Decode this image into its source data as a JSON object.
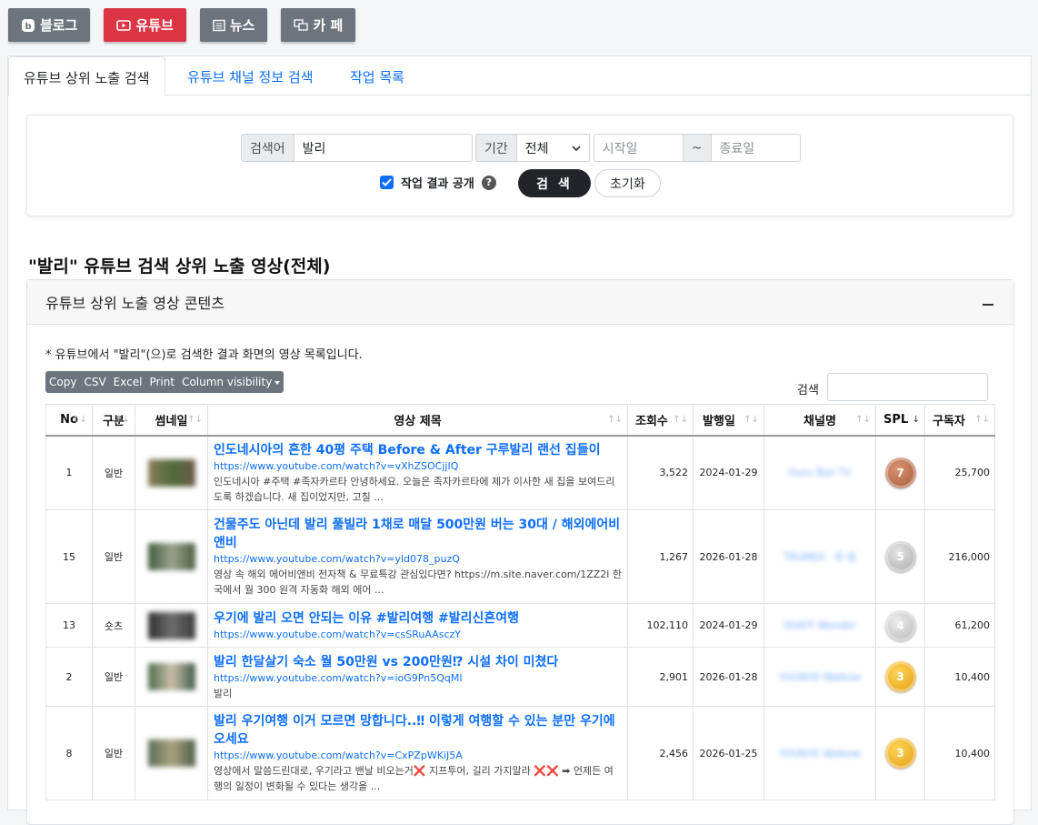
{
  "topnav": [
    {
      "label": "블로그",
      "icon": "blog-icon",
      "active": false
    },
    {
      "label": "유튜브",
      "icon": "youtube-icon",
      "active": true
    },
    {
      "label": "뉴스",
      "icon": "news-icon",
      "active": false
    },
    {
      "label": "카 페",
      "icon": "cafe-icon",
      "active": false
    }
  ],
  "tabs": [
    "유튜브 상위 노출 검색",
    "유튜브 채널 정보 검색",
    "작업 목록"
  ],
  "search": {
    "keyword_label": "검색어",
    "keyword_value": "발리",
    "period_label": "기간",
    "period_value": "전체",
    "start_placeholder": "시작일",
    "tilde": "~",
    "end_placeholder": "종료일",
    "public_label": "작업 결과 공개",
    "help": "?",
    "search_btn": "검 색",
    "reset_btn": "초기화"
  },
  "section_title": "\"발리\" 유튜브 검색 상위 노출 영상(전체)",
  "panel": {
    "title": "유튜브 상위 노출 영상 콘텐츠",
    "note": "* 유튜브에서 \"발리\"(으)로 검색한 결과 화면의 영상 목록입니다.",
    "buttons": [
      "Copy",
      "CSV",
      "Excel",
      "Print",
      "Column visibility"
    ],
    "filter_label": "검색"
  },
  "columns": [
    "No",
    "구분",
    "썸네일",
    "영상 제목",
    "조회수",
    "발행일",
    "채널명",
    "SPL",
    "구독자"
  ],
  "rows": [
    {
      "no": "1",
      "type": "일반",
      "title": "인도네시아의 흔한 40평 주택 Before & After 구루발리 랜선 집들이",
      "url": "https://www.youtube.com/watch?v=vXhZSOCjjIQ",
      "desc": "인도네시아 #주택 #족자카르타 안녕하세요. 오늘은 족자카르타에 제가 이사한 새 집을 보여드리도록 하겠습니다. 새 집이었지만, 고칠 ...",
      "views": "3,522",
      "date": "2024-01-29",
      "channel": "Guru Bali TV",
      "spl": "7",
      "medal": "#b86b4b",
      "subs": "25,700"
    },
    {
      "no": "15",
      "type": "일반",
      "title": "건물주도 아닌데 발리 풀빌라 1채로 매달 500만원 버는 30대 / 해외에어비앤비",
      "url": "https://www.youtube.com/watch?v=yld078_puzQ",
      "desc": "영상 속 해외 에어비앤비 전자책 & 무료특강 관심있다면? https://m.site.naver.com/1ZZ2l 한국에서 월 300 원격 자동화 해외 에어 ...",
      "views": "1,267",
      "date": "2026-01-28",
      "channel": "TRUMEX · 트 립",
      "spl": "5",
      "medal": "#b8b8b8",
      "subs": "216,000"
    },
    {
      "no": "13",
      "type": "숏츠",
      "title": "우기에 발리 오면 안되는 이유 #발리여행 #발리신혼여행",
      "url": "https://www.youtube.com/watch?v=csSRuAAsczY",
      "desc": "",
      "views": "102,110",
      "date": "2024-01-29",
      "channel": "SSAFF Wonder",
      "spl": "4",
      "medal": "#c8c8c8",
      "subs": "61,200"
    },
    {
      "no": "2",
      "type": "일반",
      "title": "발리 한달살기 숙소 월 50만원 vs 200만원⁉ 시설 차이 미쳤다",
      "url": "https://www.youtube.com/watch?v=ioG9Pn5QqMI",
      "desc": "발리",
      "views": "2,901",
      "date": "2026-01-28",
      "channel": "YOUNYE Walkow",
      "spl": "3",
      "medal": "#f2b418",
      "subs": "10,400"
    },
    {
      "no": "8",
      "type": "일반",
      "title": "발리 우기여행 이거 모르면 망합니다..‼ 이렇게 여행할 수 있는 분만 우기에 오세요",
      "url": "https://www.youtube.com/watch?v=CxPZpWKiJ5A",
      "desc": "영상에서 말씀드린대로, 우기라고 밴날 비오는거❌ 지프투어, 길리 가지말라 ❌❌ ➡ 언제든 여행의 일정이 변화될 수 있다는 생각을 ...",
      "views": "2,456",
      "date": "2026-01-25",
      "channel": "YOUNYE Walkow",
      "spl": "3",
      "medal": "#f2b418",
      "subs": "10,400"
    }
  ]
}
